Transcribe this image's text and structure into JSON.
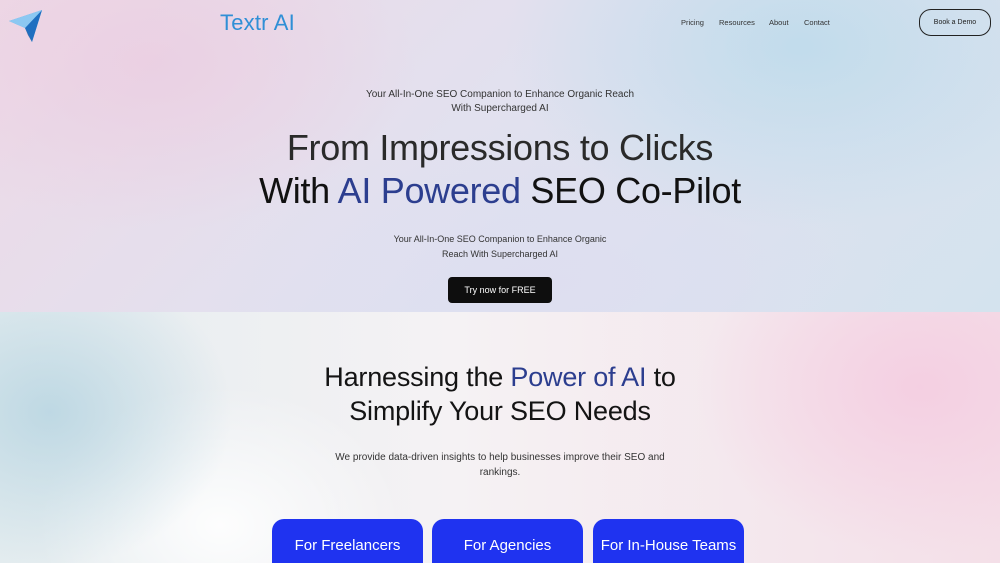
{
  "header": {
    "brand": "Textr AI",
    "nav": [
      "Pricing",
      "Resources",
      "About",
      "Contact"
    ],
    "demo_label": "Book a Demo"
  },
  "hero": {
    "tagline_line1": "Your All-In-One SEO Companion to Enhance Organic Reach",
    "tagline_line2": "With Supercharged AI",
    "headline_line1": "From Impressions to Clicks",
    "headline_line2_pre": "With ",
    "headline_line2_highlight": "AI Powered",
    "headline_line2_post": " SEO Co-Pilot",
    "sub_line1": "Your All-In-One SEO Companion to Enhance Organic",
    "sub_line2": "Reach With Supercharged AI",
    "cta_label": "Try now for FREE"
  },
  "features": {
    "title_line1_pre": "Harnessing the ",
    "title_line1_highlight": "Power of AI",
    "title_line1_post": " to",
    "title_line2": "Simplify Your SEO Needs",
    "desc_line1": "We provide data-driven insights to help businesses improve their SEO and",
    "desc_line2": "rankings.",
    "cards": [
      "For Freelancers",
      "For Agencies",
      "For In-House Teams"
    ]
  },
  "colors": {
    "brand": "#2f8fd6",
    "highlight": "#2c3e8f",
    "card_blue": "#1f33f0",
    "cta_black": "#0e0e0e"
  },
  "icons": {
    "logo": "paper-plane-icon"
  }
}
